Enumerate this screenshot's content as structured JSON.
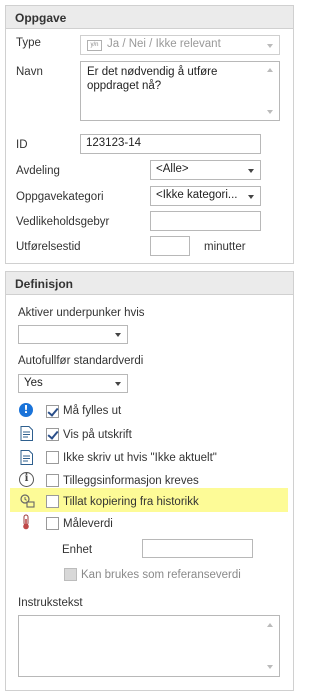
{
  "oppgave": {
    "header": "Oppgave",
    "type_label": "Type",
    "type_value": "Ja / Nei / Ikke relevant",
    "type_icon": "y/n",
    "navn_label": "Navn",
    "navn_value": "Er det nødvendig å utføre oppdraget nå?",
    "id_label": "ID",
    "id_value": "123123-14",
    "avdeling_label": "Avdeling",
    "avdeling_value": "<Alle>",
    "kategori_label": "Oppgavekategori",
    "kategori_value": "<Ikke kategori...",
    "gebyr_label": "Vedlikeholdsgebyr",
    "gebyr_value": "",
    "tid_label": "Utførelsestid",
    "tid_value": "",
    "tid_unit": "minutter"
  },
  "definisjon": {
    "header": "Definisjon",
    "aktiver_label": "Aktiver underpunker hvis",
    "aktiver_value": "",
    "autofyll_label": "Autofullfør standardverdi",
    "autofyll_value": "Yes",
    "options": [
      {
        "label": "Må fylles ut",
        "checked": true,
        "icon": "required-info-icon"
      },
      {
        "label": "Vis på utskrift",
        "checked": true,
        "icon": "document-icon"
      },
      {
        "label": "Ikke skriv ut hvis \"Ikke aktuelt\"",
        "checked": false,
        "icon": "document-icon"
      },
      {
        "label": "Tilleggsinformasjon kreves",
        "checked": false,
        "icon": "info-icon"
      },
      {
        "label": "Tillat kopiering fra historikk",
        "checked": false,
        "icon": "history-copy-icon",
        "highlighted": true
      },
      {
        "label": "Måleverdi",
        "checked": false,
        "icon": "thermometer-icon"
      }
    ],
    "enhet_label": "Enhet",
    "enhet_value": "",
    "referanse_label": "Kan brukes som referanseverdi",
    "instrukstekst_label": "Instrukstekst",
    "instrukstekst_value": ""
  },
  "colors": {
    "highlight": "#fdfb97",
    "checkmark": "#2b4f8a",
    "required_icon": "#1a73d9"
  }
}
